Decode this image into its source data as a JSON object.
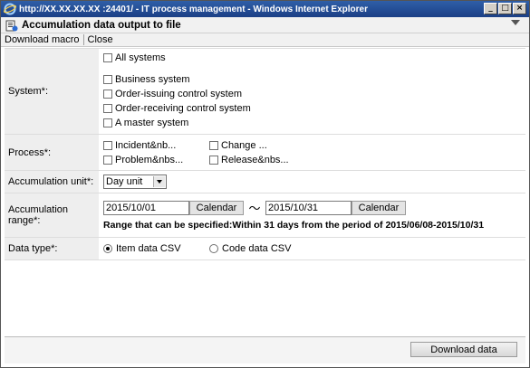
{
  "window": {
    "title": "http://XX.XX.XX.XX :24401/ - IT process management - Windows Internet Explorer",
    "min": "_",
    "max": "□",
    "close": "×"
  },
  "page": {
    "title": "Accumulation data output to file"
  },
  "menu": {
    "download_macro": "Download macro",
    "close": "Close"
  },
  "form": {
    "system": {
      "label": "System*:",
      "all": "All systems",
      "items": [
        "Business system",
        "Order-issuing control system",
        "Order-receiving control system",
        "A master system"
      ]
    },
    "process": {
      "label": "Process*:",
      "items": [
        "Incident&nb...",
        "Change ...",
        "Problem&nbs...",
        "Release&nbs..."
      ]
    },
    "unit": {
      "label": "Accumulation unit*:",
      "value": "Day unit"
    },
    "range": {
      "label": "Accumulation range*:",
      "from": "2015/10/01",
      "to": "2015/10/31",
      "calendar": "Calendar",
      "tilde": "～",
      "note": "Range that can be specified:Within 31 days from the period of 2015/06/08-2015/10/31"
    },
    "datatype": {
      "label": "Data type*:",
      "options": [
        "Item data CSV",
        "Code data CSV"
      ],
      "selected": "Item data CSV"
    }
  },
  "actions": {
    "download": "Download data"
  }
}
